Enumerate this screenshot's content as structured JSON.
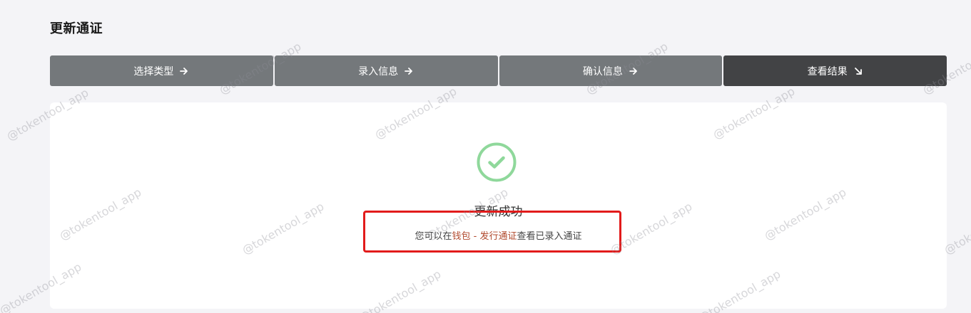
{
  "page": {
    "title": "更新通证"
  },
  "steps": [
    {
      "label": "选择类型",
      "icon": "arrow-right-icon",
      "active": false
    },
    {
      "label": "录入信息",
      "icon": "arrow-right-icon",
      "active": false
    },
    {
      "label": "确认信息",
      "icon": "arrow-right-icon",
      "active": false
    },
    {
      "label": "查看结果",
      "icon": "arrow-down-right-icon",
      "active": true
    }
  ],
  "result": {
    "icon": "check-circle-icon",
    "title": "更新成功",
    "message_prefix": "您可以在",
    "link_wallet": "钱包",
    "separator": " - ",
    "link_issue": "发行通证",
    "message_suffix": "查看已录入通证"
  },
  "watermark": {
    "text": "@tokentool_app"
  },
  "colors": {
    "step_inactive": "#74787b",
    "step_active": "#424345",
    "success_green": "#8fd89b",
    "link": "#b14a2e",
    "highlight": "#e21b1b"
  }
}
